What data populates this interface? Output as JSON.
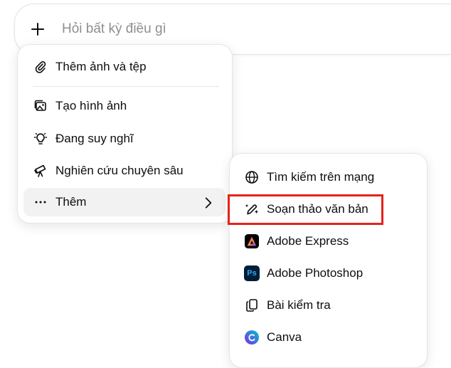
{
  "composer": {
    "placeholder": "Hỏi bất kỳ điều gì"
  },
  "menu": {
    "items": [
      {
        "label": "Thêm ảnh và tệp",
        "icon": "paperclip-icon"
      },
      {
        "label": "Tạo hình ảnh",
        "icon": "image-icon"
      },
      {
        "label": "Đang suy nghĩ",
        "icon": "lightbulb-icon"
      },
      {
        "label": "Nghiên cứu chuyên sâu",
        "icon": "telescope-icon"
      },
      {
        "label": "Thêm",
        "icon": "more-dots-icon"
      }
    ]
  },
  "submenu": {
    "items": [
      {
        "label": "Tìm kiếm trên mạng",
        "icon": "globe-icon"
      },
      {
        "label": "Soạn thảo văn bản",
        "icon": "pen-sparkle-icon"
      },
      {
        "label": "Adobe Express",
        "icon": "adobe-express-icon"
      },
      {
        "label": "Adobe Photoshop",
        "icon": "adobe-photoshop-icon",
        "badge": "Ps"
      },
      {
        "label": "Bài kiểm tra",
        "icon": "quiz-cards-icon"
      },
      {
        "label": "Canva",
        "icon": "canva-icon",
        "badge": "C"
      }
    ]
  },
  "colors": {
    "highlight": "#e5221b",
    "photoshop_bg": "#001e36",
    "photoshop_fg": "#31a8ff"
  }
}
